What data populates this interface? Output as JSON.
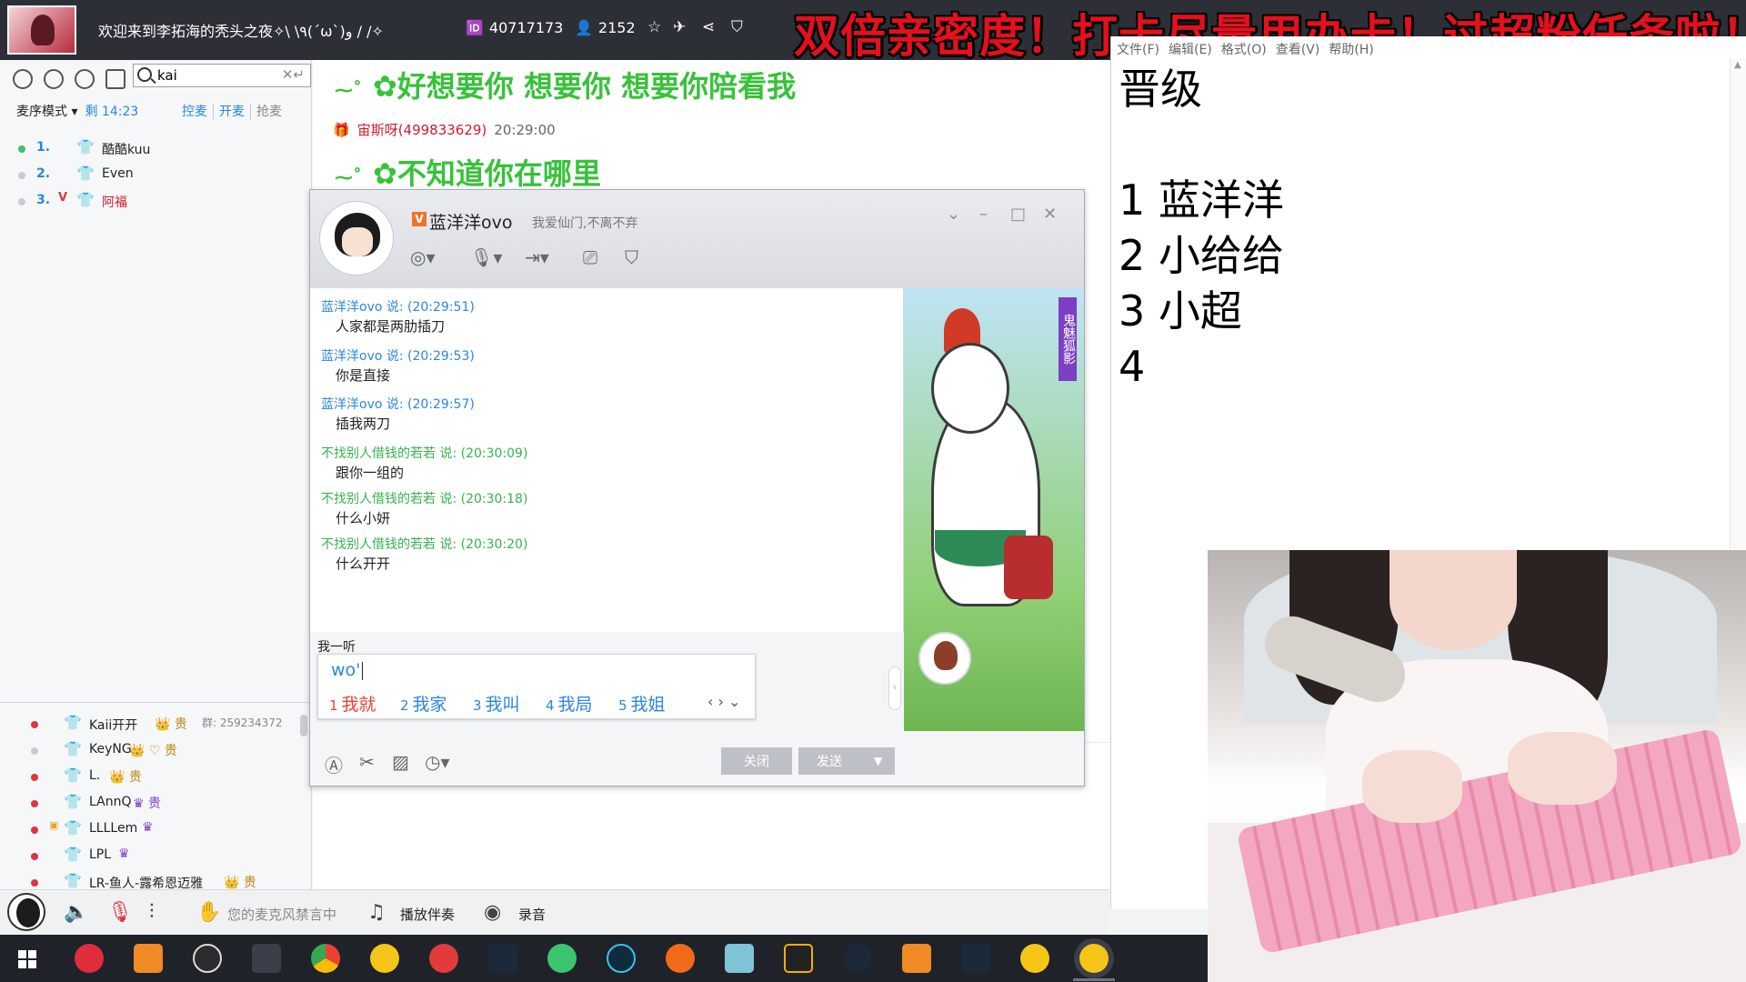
{
  "topbar": {
    "room_title": "欢迎来到李拓海的秃头之夜✧\\ \\٩(ˊωˋ)و / /✧",
    "room_id": "40717173",
    "online": "2152",
    "banner": "双倍亲密度！打卡尽量用办卡！过超粉任务啦！"
  },
  "left": {
    "search_value": "kai",
    "mic_mode": "麦序模式",
    "remain": "剩 14:23",
    "actions": [
      "控麦",
      "开麦",
      "抢麦"
    ],
    "queue": [
      {
        "num": "1.",
        "name": "酷酷kuu",
        "dot": "#3cc46e"
      },
      {
        "num": "2.",
        "name": "Even",
        "dot": "#c9ccd1"
      },
      {
        "num": "3.",
        "name": "阿福",
        "dot": "#c9ccd1"
      }
    ],
    "members": [
      {
        "name": "Kaii开开",
        "badges": "👑 贵",
        "extra": "群: 259234372"
      },
      {
        "name": "KeyNG",
        "badges": "👑 ♡ 贵",
        "extra": ""
      },
      {
        "name": "L.",
        "badges": "👑 贵",
        "extra": ""
      },
      {
        "name": "LAnnQ",
        "badges": "♛ 贵",
        "extra": ""
      },
      {
        "name": "LLLLem",
        "badges": "♛",
        "extra": ""
      },
      {
        "name": "LPL",
        "badges": "♛",
        "extra": ""
      },
      {
        "name": "LR-鱼人-露希恩迈雅",
        "badges": "👑 贵",
        "extra": ""
      }
    ]
  },
  "chat": {
    "big1": "✿好想要你 想要你 想要你陪看我",
    "sender": "宙斯呀(499833629)",
    "sender_time": "20:29:00",
    "big2": "✿不知道你在哪里"
  },
  "pm": {
    "name": "蓝洋洋ovo",
    "signature": "我爱仙门,不离不弃",
    "messages": [
      {
        "head": "蓝洋洋ovo 说: (20:29:51)",
        "body": "人家都是两肋插刀",
        "color": "blue"
      },
      {
        "head": "蓝洋洋ovo 说: (20:29:53)",
        "body": "你是直接",
        "color": "blue"
      },
      {
        "head": "蓝洋洋ovo 说: (20:29:57)",
        "body": "插我两刀",
        "color": "blue"
      },
      {
        "head": "不找别人借钱的若若 说: (20:30:09)",
        "body": "跟你一组的",
        "color": "green"
      },
      {
        "head": "不找别人借钱的若若 说: (20:30:18)",
        "body": "什么小妍",
        "color": "green"
      },
      {
        "head": "不找别人借钱的若若 说: (20:30:20)",
        "body": "什么开开",
        "color": "green"
      }
    ],
    "side_ribbon": "鬼魅狐影",
    "compose_text": "我一听",
    "ime_input": "wo'",
    "ime_candidates": [
      {
        "n": "1",
        "text": "我就"
      },
      {
        "n": "2",
        "text": "我家"
      },
      {
        "n": "3",
        "text": "我叫"
      },
      {
        "n": "4",
        "text": "我局"
      },
      {
        "n": "5",
        "text": "我姐"
      }
    ],
    "close_label": "关闭",
    "send_label": "发送"
  },
  "audio": {
    "mic_banned": "您的麦克风禁言中",
    "play_accomp": "播放伴奏",
    "record": "录音"
  },
  "notepad": {
    "menu": [
      "文件(F)",
      "编辑(E)",
      "格式(O)",
      "查看(V)",
      "帮助(H)"
    ],
    "content": "晋级\n\n1 蓝洋洋\n2 小给给\n3 小超\n4"
  }
}
